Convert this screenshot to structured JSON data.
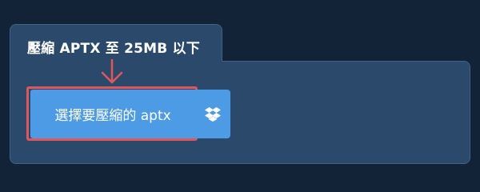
{
  "compress_tab": {
    "title": "壓縮 APTX 至 25MB 以下"
  },
  "upload": {
    "button_label": "選擇要壓縮的 aptx"
  },
  "icons": {
    "arrow": "arrow-down-icon",
    "dropbox": "dropbox-icon"
  },
  "colors": {
    "background": "#132337",
    "panel": "#2b4a6b",
    "button": "#4d9be5",
    "highlight": "#e0565b"
  }
}
